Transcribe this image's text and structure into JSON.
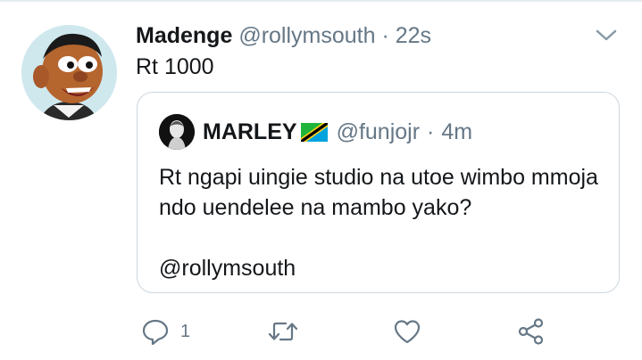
{
  "tweet": {
    "display_name": "Madenge",
    "handle": "@rollymsouth",
    "separator": "·",
    "time": "22s",
    "text": "Rt 1000"
  },
  "quoted_tweet": {
    "display_name": "MARLEY",
    "flag_icon": "tanzania-flag",
    "handle": "@funjojr",
    "separator": "·",
    "time": "4m",
    "text_line1": "Rt ngapi uingie studio na utoe wimbo mmoja",
    "text_line2": "ndo uendelee na mambo yako?",
    "mention": "@rollymsouth"
  },
  "actions": {
    "reply_count": "1",
    "retweet_count": "",
    "like_count": ""
  },
  "icons": [
    "caricature-avatar",
    "chevron-down-icon",
    "reply-icon",
    "retweet-icon",
    "like-icon",
    "share-icon"
  ],
  "colors": {
    "text": "#14171a",
    "muted": "#657786",
    "border": "#ccd6dd"
  }
}
